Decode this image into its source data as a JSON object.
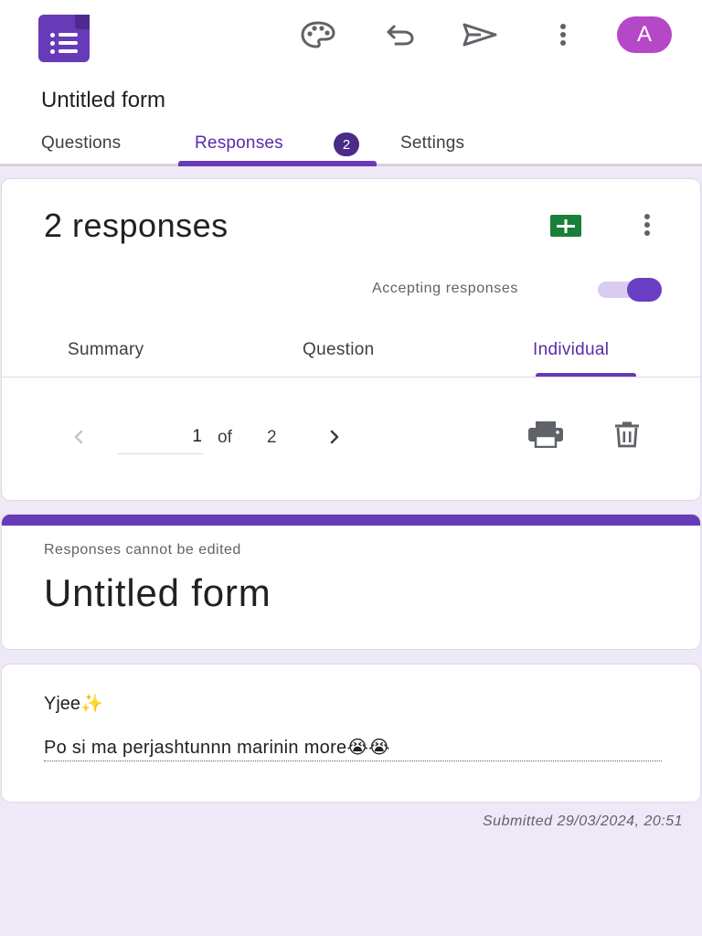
{
  "app": {
    "logo_icon": "google-forms-icon",
    "accent_color": "#673ab7",
    "avatar_letter": "A",
    "avatar_color": "#b548c6"
  },
  "toolbar": {
    "icons": [
      "palette-icon",
      "undo-icon",
      "send-icon",
      "more-vert-icon"
    ]
  },
  "form": {
    "title": "Untitled form"
  },
  "tabs": [
    {
      "label": "Questions"
    },
    {
      "label": "Responses",
      "badge": "2",
      "active": true
    },
    {
      "label": "Settings"
    }
  ],
  "responses": {
    "count_label": "2 responses",
    "accepting_label": "Accepting responses",
    "accepting": true,
    "subtabs": [
      {
        "label": "Summary"
      },
      {
        "label": "Question"
      },
      {
        "label": "Individual",
        "active": true
      }
    ],
    "pager": {
      "current": "1",
      "of_label": "of",
      "total": "2"
    }
  },
  "response_view": {
    "notice": "Responses cannot be edited",
    "form_title": "Untitled form",
    "question": "Yjee✨",
    "answer": "Po si ma perjashtunnn marinin more😭😭",
    "submitted": "Submitted 29/03/2024, 20:51"
  }
}
